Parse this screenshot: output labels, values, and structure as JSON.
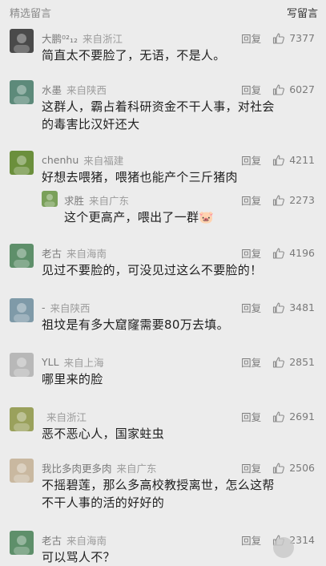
{
  "header": {
    "title": "精选留言",
    "write_label": "写留言"
  },
  "reply_label": "回复",
  "comments": [
    {
      "nick": "大鹏⁰²₁₂",
      "loc": "来自浙江",
      "likes": "7377",
      "text": [
        "简直太不要脸了，无语，不是人。"
      ],
      "avatar_color": "#4a4a4a"
    },
    {
      "nick": "水墨",
      "loc": "来自陕西",
      "likes": "6027",
      "text": [
        "这群人，霸占着科研资金不干人事，对社会",
        "的毒害比汉奸还大"
      ],
      "avatar_color": "#5d8a7a"
    },
    {
      "nick": "chenhu",
      "loc": "来自福建",
      "likes": "4211",
      "text": [
        "好想去喂猪，喂猪也能产个三斤猪肉"
      ],
      "avatar_color": "#6b8f3c",
      "sub": {
        "nick": "求胜",
        "loc": "来自广东",
        "likes": "2273",
        "text": "这个更高产，喂出了一群🐷",
        "avatar_color": "#7aa05a"
      }
    },
    {
      "nick": "老古",
      "loc": "来自海南",
      "likes": "4196",
      "text": [
        "见过不要脸的，可没见过这么不要脸的！"
      ],
      "avatar_color": "#5e8f6a"
    },
    {
      "nick": "-",
      "loc": "来自陕西",
      "likes": "3481",
      "text": [
        "祖坟是有多大窟窿需要80万去填。"
      ],
      "avatar_color": "#7f9aa8"
    },
    {
      "nick": "YLL",
      "loc": "来自上海",
      "likes": "2851",
      "text": [
        "哪里来的脸"
      ],
      "avatar_color": "#b8b8b8"
    },
    {
      "nick": "",
      "loc": "来自浙江",
      "likes": "2691",
      "text": [
        "恶不恶心人，国家蛀虫"
      ],
      "avatar_color": "#9aa15c"
    },
    {
      "nick": "我比多肉更多肉",
      "loc": "来自广东",
      "likes": "2506",
      "text": [
        "不摇碧莲，那么多高校教授离世，怎么这帮",
        "不干人事的活的好好的"
      ],
      "avatar_color": "#c9b8a0"
    },
    {
      "nick": "老古",
      "loc": "来自海南",
      "likes": "2314",
      "text": [
        "可以骂人不？"
      ],
      "avatar_color": "#5e8f6a"
    }
  ]
}
